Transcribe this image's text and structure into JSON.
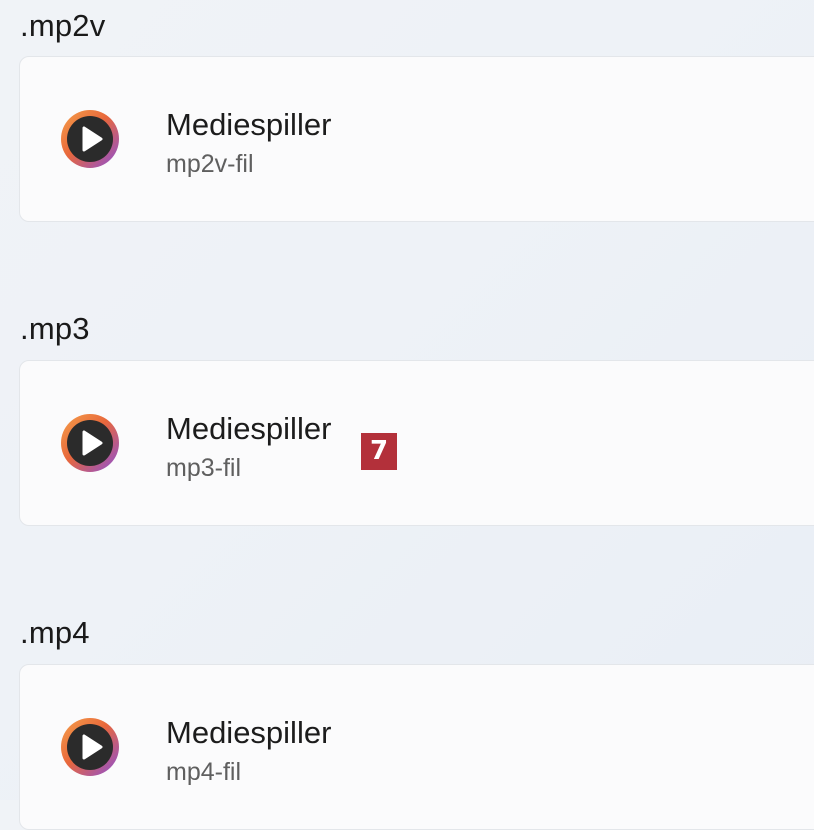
{
  "associations": [
    {
      "extension": ".mp2v",
      "app_name": "Mediespiller",
      "file_type": "mp2v-fil",
      "app_icon": "media-player-icon"
    },
    {
      "extension": ".mp3",
      "app_name": "Mediespiller",
      "file_type": "mp3-fil",
      "app_icon": "media-player-icon"
    },
    {
      "extension": ".mp4",
      "app_name": "Mediespiller",
      "file_type": "mp4-fil",
      "app_icon": "media-player-icon"
    }
  ],
  "overlay_badge": {
    "label": "7",
    "color": "#b3303a"
  },
  "colors": {
    "icon_ring_start": "#f08a3c",
    "icon_ring_end": "#8a4fd8",
    "icon_fill": "#2b2b2b"
  }
}
